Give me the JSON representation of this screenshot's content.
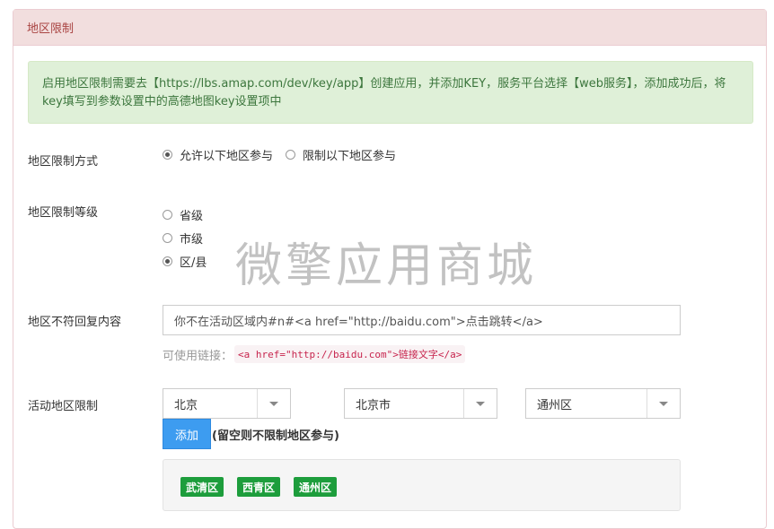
{
  "panel": {
    "title": "地区限制"
  },
  "alert": {
    "text": "启用地区限制需要去【https://lbs.amap.com/dev/key/app】创建应用，并添加KEY，服务平台选择【web服务】，添加成功后，将key填写到参数设置中的高德地图key设置项中"
  },
  "mode": {
    "label": "地区限制方式",
    "options": [
      "允许以下地区参与",
      "限制以下地区参与"
    ],
    "selected": 0
  },
  "level": {
    "label": "地区限制等级",
    "options": [
      "省级",
      "市级",
      "区/县"
    ],
    "selected": 2
  },
  "reply": {
    "label": "地区不符回复内容",
    "value": "你不在活动区域内#n#<a href=\"http://baidu.com\">点击跳转</a>",
    "help_prefix": "可使用链接：",
    "help_code": "<a href=\"http://baidu.com\">链接文字</a>"
  },
  "area": {
    "label": "活动地区限制",
    "province": "北京",
    "city": "北京市",
    "district": "通州区",
    "add_button": "添加",
    "add_note": "(留空则不限制地区参与)",
    "tags": [
      "武清区",
      "西青区",
      "通州区"
    ]
  },
  "watermark": "微擎应用商城",
  "colors": {
    "heading_bg": "#f2dede",
    "heading_text": "#a94442",
    "alert_bg": "#dff0d8",
    "alert_text": "#3c763d",
    "primary_button": "#3d9cf0",
    "tag_green": "#1d9d3c"
  }
}
